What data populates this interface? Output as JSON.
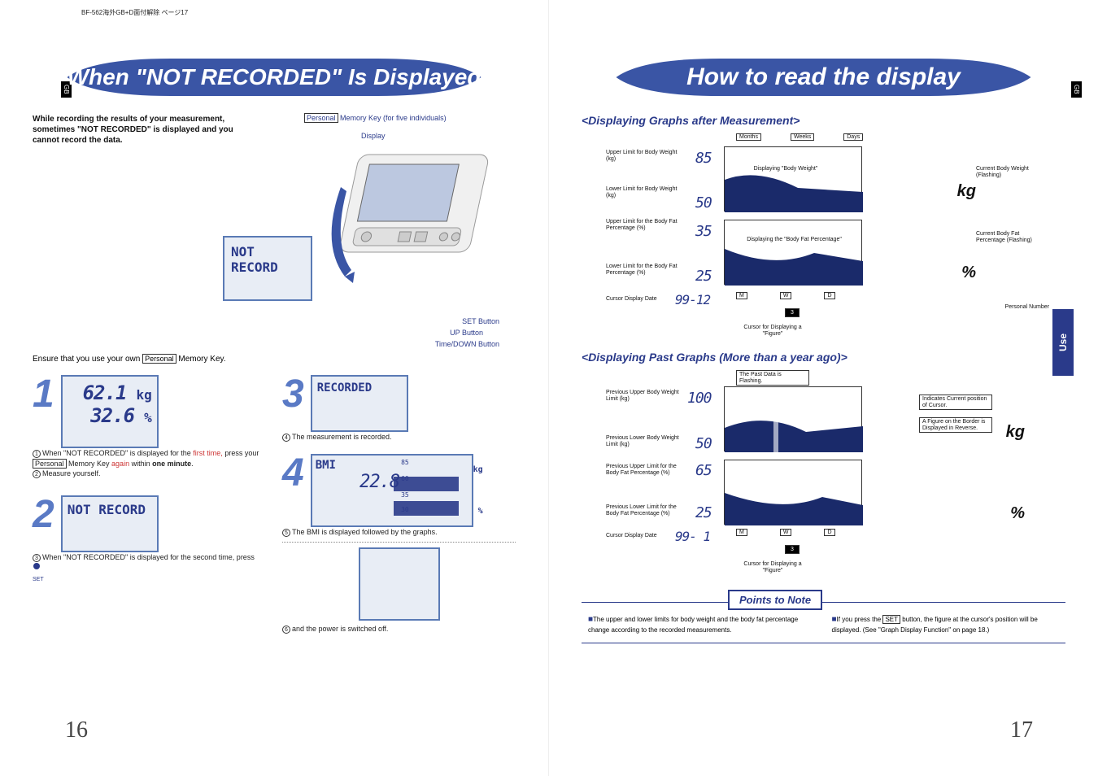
{
  "header_path": "BF-562海外GB+D面付解除 ページ17",
  "gb_label": "GB",
  "use_label": "Use",
  "page_numbers": {
    "left": "16",
    "right": "17"
  },
  "left": {
    "banner": "When \"NOT RECORDED\" Is Displayed",
    "intro": "While recording the results of your measurement, sometimes \"NOT RECORDED\" is displayed and you cannot record the data.",
    "device_callouts": {
      "personal_key": {
        "boxed": "Personal",
        "rest": "Memory Key (for five individuals)"
      },
      "display": "Display",
      "set_btn": "SET Button",
      "up_btn": "UP Button",
      "time_down_btn": "Time/DOWN Button"
    },
    "device_screen": "NOT\nRECORD",
    "ensure_line": {
      "pre": "Ensure that you use your own ",
      "boxed": "Personal",
      "post": " Memory Key."
    },
    "steps": {
      "s1": {
        "num": "1",
        "lcd": {
          "line1": "62.1",
          "unit1": "kg",
          "line2": "32.6",
          "unit2": "%"
        },
        "text1": {
          "circ": "1",
          "pre": "When \"NOT RECORDED\" is displayed for the ",
          "hl": "first time,",
          "mid": " press your ",
          "boxed": "Personal",
          "mid2": " Memory Key ",
          "hl2": "again",
          "post": " within ",
          "bold": "one minute",
          "end": "."
        },
        "text2": {
          "circ": "2",
          "body": "Measure yourself."
        }
      },
      "s2": {
        "num": "2",
        "lcd": "NOT\nRECORD",
        "text": {
          "circ": "3",
          "pre": "When \"NOT RECORDED\" is displayed for the second time, press ",
          "icon_label": "SET"
        }
      },
      "s3": {
        "num": "3",
        "lcd": "RECORDED",
        "text": {
          "circ": "4",
          "body": "The measurement is recorded."
        }
      },
      "s4": {
        "num": "4",
        "lcd": {
          "title": "BMI",
          "value": "22.8",
          "axis": [
            "85",
            "60",
            "35",
            "30"
          ],
          "units": [
            "kg",
            "%"
          ]
        },
        "text": {
          "circ": "5",
          "body": "The BMI is displayed followed by the graphs."
        }
      },
      "s5": {
        "text": {
          "circ": "6",
          "body": "and the power is switched off."
        }
      }
    }
  },
  "right": {
    "banner": "How to read the display",
    "section1": {
      "heading": "<Displaying Graphs after Measurement>",
      "labels": {
        "months": "Months",
        "weeks": "Weeks",
        "days": "Days",
        "upper_weight": "Upper Limit for Body Weight (kg)",
        "lower_weight": "Lower Limit for Body Weight (kg)",
        "upper_fat": "Upper Limit for the Body Fat Percentage (%)",
        "lower_fat": "Lower Limit for the Body Fat Percentage (%)",
        "cursor_date": "Cursor Display Date",
        "disp_weight": "Displaying \"Body Weight\"",
        "disp_fat": "Displaying the \"Body Fat Percentage\"",
        "cur_weight": "Current Body Weight (Flashing)",
        "cur_fat": "Current Body Fat Percentage (Flashing)",
        "personal_num": "Personal Number",
        "cursor_fig": "Cursor for Displaying a \"Figure\""
      },
      "values": {
        "v85": "85",
        "v50": "50",
        "v35": "35",
        "v25": "25",
        "date": "99-12",
        "pnum": "3",
        "kg": "kg",
        "pct": "%"
      },
      "mwd": {
        "m": "M",
        "w": "W",
        "d": "D"
      }
    },
    "section2": {
      "heading": "<Displaying Past Graphs (More than a year ago)>",
      "labels": {
        "past_flash": "The Past Data is Flashing.",
        "ind_cursor": "Indicates Current position of Cursor.",
        "fig_reverse": "A Figure on the Border is Displayed in Reverse.",
        "prev_upper_w": "Previous Upper Body Weight Limit (kg)",
        "prev_lower_w": "Previous Lower Body Weight Limit (kg)",
        "prev_upper_f": "Previous Upper Limit for the Body Fat Percentage (%)",
        "prev_lower_f": "Previous Lower Limit for the Body Fat Percentage (%)",
        "cursor_date": "Cursor Display Date",
        "cursor_fig": "Cursor for Displaying a \"Figure\""
      },
      "values": {
        "v100": "100",
        "v50": "50",
        "v65": "65",
        "v25": "25",
        "date": "99- 1",
        "pnum": "3",
        "kg": "kg",
        "pct": "%"
      },
      "mwd": {
        "m": "M",
        "w": "W",
        "d": "D"
      }
    },
    "points": {
      "title": "Points to Note",
      "p1": "The upper and lower limits for body weight and the body fat percentage change according to the recorded measurements.",
      "p2_pre": "If you press the ",
      "p2_box": "SET",
      "p2_post": " button, the figure at the cursor's position will be displayed. (See \"Graph Display Function\" on page 18.)"
    }
  }
}
